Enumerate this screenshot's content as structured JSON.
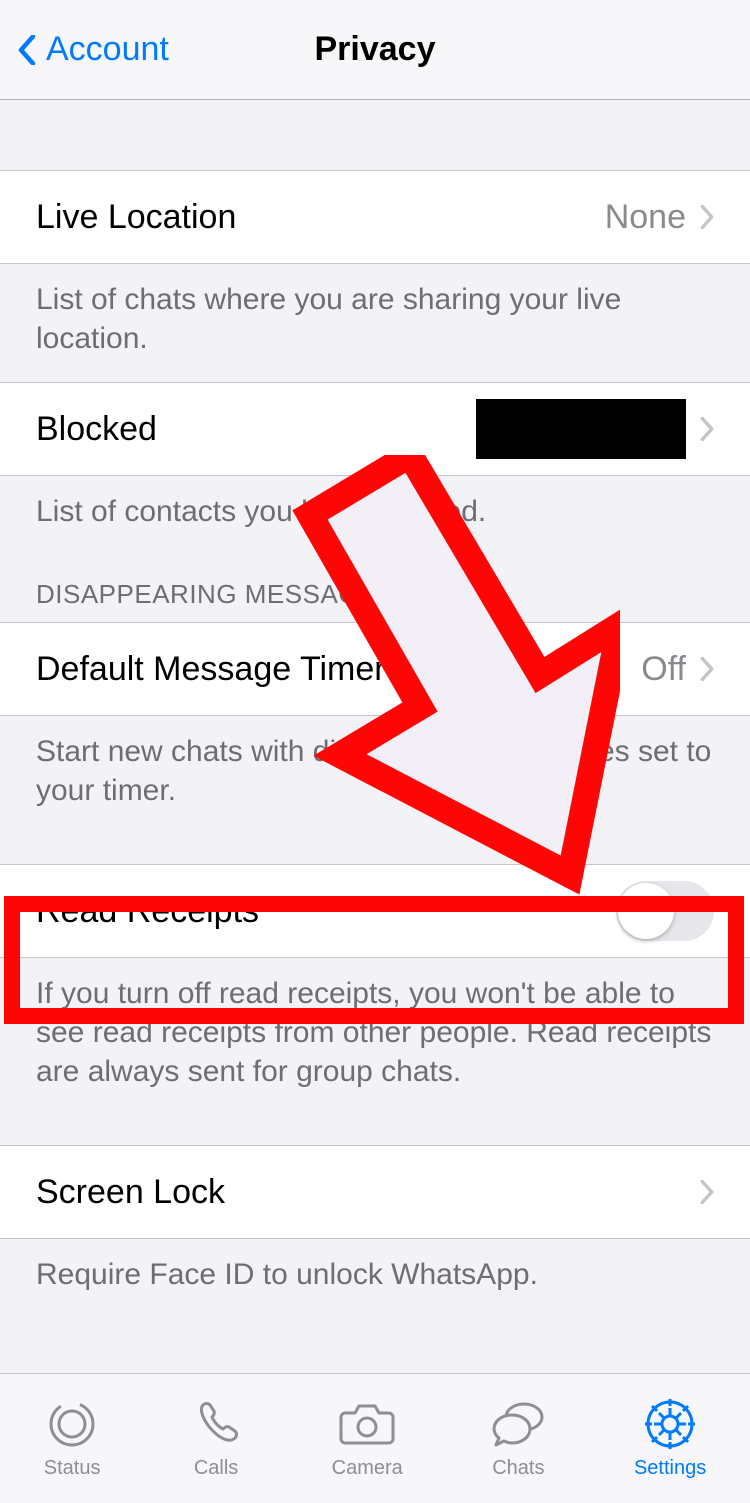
{
  "header": {
    "back_label": "Account",
    "title": "Privacy"
  },
  "live_location": {
    "label": "Live Location",
    "value": "None",
    "desc": "List of chats where you are sharing your live location."
  },
  "blocked": {
    "label": "Blocked",
    "desc": "List of contacts you have blocked."
  },
  "disappearing": {
    "header": "DISAPPEARING MESSAGES",
    "timer_label": "Default Message Timer",
    "timer_value": "Off",
    "desc": "Start new chats with disappearing messages set to your timer."
  },
  "read_receipts": {
    "label": "Read Receipts",
    "desc": "If you turn off read receipts, you won't be able to see read receipts from other people. Read receipts are always sent for group chats."
  },
  "screen_lock": {
    "label": "Screen Lock",
    "desc": "Require Face ID to unlock WhatsApp."
  },
  "tabs": {
    "status": "Status",
    "calls": "Calls",
    "camera": "Camera",
    "chats": "Chats",
    "settings": "Settings"
  }
}
